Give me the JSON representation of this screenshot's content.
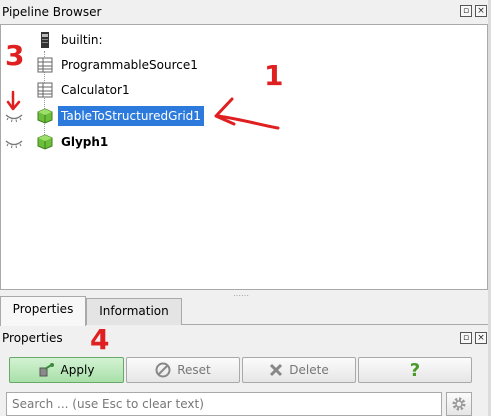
{
  "pipeline_browser": {
    "title": "Pipeline Browser",
    "dock_buttons": [
      "float-icon",
      "close-icon"
    ],
    "items": [
      {
        "label": "builtin:",
        "icon": "server-icon",
        "visible": null,
        "selected": false,
        "bold": false
      },
      {
        "label": "ProgrammableSource1",
        "icon": "table-icon",
        "visible": null,
        "selected": false,
        "bold": false
      },
      {
        "label": "Calculator1",
        "icon": "table-icon",
        "visible": null,
        "selected": false,
        "bold": false
      },
      {
        "label": "TableToStructuredGrid1",
        "icon": "cube-icon",
        "visible": false,
        "selected": true,
        "bold": false
      },
      {
        "label": "Glyph1",
        "icon": "cube-icon",
        "visible": false,
        "selected": false,
        "bold": true
      }
    ]
  },
  "tabs": [
    {
      "label": "Properties",
      "active": true
    },
    {
      "label": "Information",
      "active": false
    }
  ],
  "properties": {
    "title": "Properties",
    "apply_label": "Apply",
    "reset_label": "Reset",
    "delete_label": "Delete",
    "help_label": "?",
    "search_placeholder": "Search ... (use Esc to clear text)",
    "search_value": ""
  },
  "annotations": [
    "1",
    "3",
    "4"
  ],
  "colors": {
    "selection": "#2c7bdc",
    "annotation": "#e02020",
    "apply_bg": "#a9e0a9",
    "cube": "#6cbf3a"
  }
}
